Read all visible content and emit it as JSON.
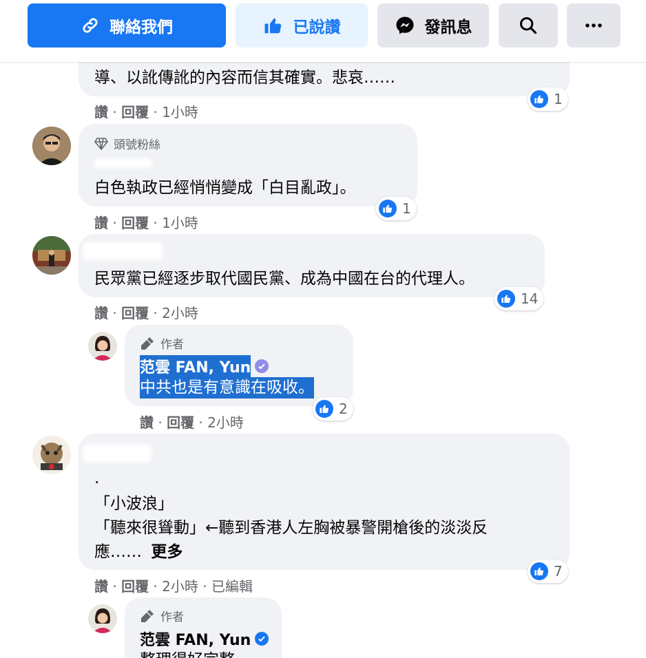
{
  "top_actions": {
    "contact_label": "聯絡我們",
    "liked_label": "已說讚",
    "message_label": "發訊息"
  },
  "colors": {
    "brand_blue": "#1877f2",
    "bubble_bg": "#f0f2f5",
    "meta_text": "#65676b",
    "selection": "#1f6fd0"
  },
  "comments": [
    {
      "text_lines": [
        "導、以訛傳訛的內容而信其確實。悲哀……"
      ],
      "actions": {
        "like": "讚",
        "reply": "回覆",
        "time": "1小時"
      },
      "reactions": "1"
    },
    {
      "badge": "頭號粉絲",
      "text_lines": [
        "白色執政已經悄悄變成「白目亂政」。"
      ],
      "actions": {
        "like": "讚",
        "reply": "回覆",
        "time": "1小時"
      },
      "reactions": "1"
    },
    {
      "text_lines": [
        "民眾黨已經逐步取代國民黨、成為中國在台的代理人。"
      ],
      "actions": {
        "like": "讚",
        "reply": "回覆",
        "time": "2小時"
      },
      "reactions": "14"
    },
    {
      "text_lines": [
        ".",
        "「小波浪」",
        "「聽來很聳動」←聽到香港人左胸被暴警開槍後的淡淡反",
        "應……"
      ],
      "see_more": "更多",
      "actions": {
        "like": "讚",
        "reply": "回覆",
        "time": "2小時",
        "edited": "已編輯"
      },
      "reactions": "7"
    }
  ],
  "replies": [
    {
      "author_label": "作者",
      "author": "范雲 FAN, Yun",
      "text": "中共也是有意識在吸收。",
      "actions": {
        "like": "讚",
        "reply": "回覆",
        "time": "2小時"
      },
      "reactions": "2"
    },
    {
      "author_label": "作者",
      "author": "范雲 FAN, Yun",
      "text": "整理得好完整"
    }
  ]
}
